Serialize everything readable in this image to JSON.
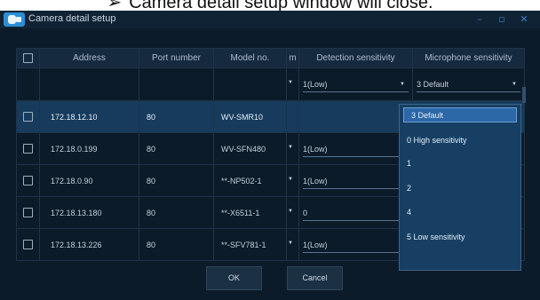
{
  "caption": {
    "bullet": "➢",
    "text": "Camera detail setup window will close."
  },
  "window": {
    "title": "Camera detail setup",
    "minimize_glyph": "–",
    "maximize_glyph": "▫",
    "close_glyph": "✕"
  },
  "table": {
    "columns": [
      "Address",
      "Port number",
      "Model no.",
      "m",
      "Detection sensitivity",
      "Microphone sensitivity"
    ],
    "blank_row": {
      "detection": "1(Low)",
      "microphone": "3 Default"
    },
    "rows": [
      {
        "address": "172.18.12.10",
        "port": "80",
        "model": "WV-SMR10",
        "detection": "",
        "selected": true
      },
      {
        "address": "172.18.0.199",
        "port": "80",
        "model": "WV-SFN480",
        "detection": "1(Low)",
        "selected": false
      },
      {
        "address": "172.18.0.90",
        "port": "80",
        "model": "**-NP502-1",
        "detection": "1(Low)",
        "selected": false
      },
      {
        "address": "172.18.13.180",
        "port": "80",
        "model": "**-X6511-1",
        "detection": "0",
        "selected": false
      },
      {
        "address": "172.18.13.226",
        "port": "80",
        "model": "**-SFV781-1",
        "detection": "1(Low)",
        "selected": false
      }
    ]
  },
  "dropdown": {
    "options": [
      "3 Default",
      "0 High sensitivity",
      "1",
      "2",
      "4",
      "5 Low sensitivity"
    ],
    "selected": "3 Default"
  },
  "buttons": {
    "ok": "OK",
    "cancel": "Cancel"
  },
  "icons": {
    "app": "camera-app-icon",
    "dropdown_arrow": "chevron-down-icon",
    "checkbox": "checkbox-icon"
  },
  "colors": {
    "window_bg": "#0c1b2a",
    "header_bg": "#152a3e",
    "selected_row": "#163b5c",
    "dropdown_bg": "#163f63",
    "dropdown_active": "#2c67a8"
  }
}
